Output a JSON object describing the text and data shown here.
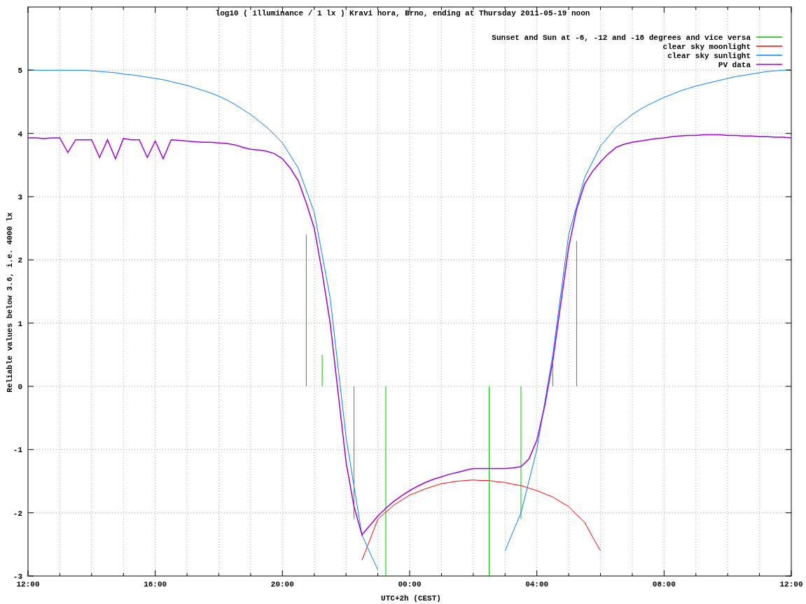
{
  "chart_data": {
    "type": "line",
    "title": "log10 ( illuminance / 1 lx ) Kravi hora, Brno, ending at Thursday 2011-05-19 noon",
    "xlabel": "UTC+2h (CEST)",
    "ylabel": "Reliable values below 3.6, i.e. 4000 lx",
    "categories": [
      "12:00",
      null,
      null,
      null,
      null,
      null,
      null,
      null,
      null,
      null,
      null,
      null,
      null,
      null,
      null,
      null,
      "16:00",
      null,
      null,
      null,
      null,
      null,
      null,
      null,
      null,
      null,
      null,
      null,
      null,
      null,
      null,
      null,
      "20:00",
      null,
      null,
      null,
      null,
      null,
      null,
      null,
      null,
      null,
      null,
      null,
      null,
      null,
      null,
      null,
      "00:00",
      null,
      null,
      null,
      null,
      null,
      null,
      null,
      null,
      null,
      null,
      null,
      null,
      null,
      null,
      null,
      "04:00",
      null,
      null,
      null,
      null,
      null,
      null,
      null,
      null,
      null,
      null,
      null,
      null,
      null,
      null,
      null,
      "08:00",
      null,
      null,
      null,
      null,
      null,
      null,
      null,
      null,
      null,
      null,
      null,
      null,
      null,
      null,
      null,
      "12:00"
    ],
    "ylim": [
      -3,
      6
    ],
    "yticks": [
      -3,
      -2,
      -1,
      0,
      1,
      2,
      3,
      4,
      5
    ],
    "grid": true,
    "legend": true,
    "series": [
      {
        "name": "Sunset and Sun at -6, -12 and -18 degrees and vice versa",
        "color": "#00c000",
        "type": "bar",
        "values": [
          null,
          null,
          null,
          null,
          null,
          null,
          null,
          null,
          null,
          null,
          null,
          null,
          null,
          null,
          null,
          null,
          null,
          null,
          null,
          null,
          null,
          null,
          null,
          null,
          null,
          null,
          null,
          null,
          null,
          null,
          null,
          null,
          null,
          null,
          null,
          2.4,
          null,
          0.5,
          null,
          null,
          null,
          -2.1,
          null,
          null,
          null,
          -3,
          null,
          null,
          null,
          null,
          null,
          null,
          null,
          null,
          null,
          null,
          null,
          null,
          -3,
          null,
          null,
          null,
          -2.1,
          null,
          null,
          null,
          0.35,
          null,
          null,
          2.3,
          null,
          null,
          null,
          null,
          null,
          null,
          null,
          null,
          null,
          null,
          null,
          null,
          null,
          null,
          null,
          null,
          null,
          null,
          null,
          null,
          null,
          null,
          null,
          null,
          null,
          null,
          null
        ]
      },
      {
        "name": "clear sky moonlight",
        "color": "#ff0000",
        "values": [
          null,
          null,
          null,
          null,
          null,
          null,
          null,
          null,
          null,
          null,
          null,
          null,
          null,
          null,
          null,
          null,
          null,
          null,
          null,
          null,
          null,
          null,
          null,
          null,
          null,
          null,
          null,
          null,
          null,
          null,
          null,
          null,
          null,
          null,
          null,
          null,
          null,
          null,
          null,
          null,
          null,
          null,
          -2.75,
          -2.43,
          -2.1,
          -1.99,
          -1.88,
          -1.8,
          -1.72,
          -1.67,
          -1.62,
          -1.58,
          -1.54,
          -1.52,
          -1.5,
          -1.49,
          -1.48,
          -1.49,
          -1.49,
          -1.51,
          -1.52,
          -1.55,
          -1.57,
          -1.61,
          -1.65,
          -1.7,
          -1.75,
          -1.83,
          -1.9,
          -2.03,
          -2.15,
          -2.38,
          -2.6,
          null,
          null,
          null,
          null,
          null,
          null,
          null,
          null,
          null,
          null,
          null,
          null,
          null,
          null,
          null,
          null,
          null,
          null,
          null,
          null,
          null,
          null,
          null,
          null
        ]
      },
      {
        "name": "clear sky sunlight",
        "color": "#0080ff",
        "values": [
          5.01,
          5.0,
          5.0,
          5.0,
          5.0,
          5.0,
          5.0,
          5.0,
          4.99,
          4.98,
          4.97,
          4.96,
          4.94,
          4.93,
          4.91,
          4.89,
          4.87,
          4.85,
          4.82,
          4.79,
          4.76,
          4.72,
          4.68,
          4.64,
          4.59,
          4.53,
          4.46,
          4.38,
          4.3,
          4.2,
          4.1,
          3.98,
          3.85,
          3.65,
          3.45,
          3.1,
          2.75,
          2.08,
          1.4,
          0.3,
          -0.8,
          -1.58,
          -2.35,
          -2.63,
          -2.9,
          null,
          null,
          null,
          null,
          null,
          null,
          null,
          null,
          null,
          null,
          null,
          null,
          null,
          null,
          null,
          -2.6,
          -2.3,
          -2.0,
          -1.5,
          -1.0,
          -0.25,
          0.5,
          1.45,
          2.4,
          2.85,
          3.3,
          3.55,
          3.8,
          3.95,
          4.1,
          4.2,
          4.3,
          4.38,
          4.45,
          4.51,
          4.57,
          4.62,
          4.67,
          4.71,
          4.75,
          4.78,
          4.81,
          4.84,
          4.87,
          4.9,
          4.92,
          4.94,
          4.96,
          4.98,
          4.99,
          5.0,
          5.01
        ]
      },
      {
        "name": "PV data",
        "color": "#a000e0",
        "values": [
          3.93,
          3.93,
          3.92,
          3.93,
          3.93,
          3.7,
          3.9,
          3.9,
          3.9,
          3.62,
          3.9,
          3.6,
          3.92,
          3.9,
          3.9,
          3.62,
          3.88,
          3.6,
          3.9,
          3.89,
          3.88,
          3.87,
          3.86,
          3.86,
          3.85,
          3.84,
          3.82,
          3.78,
          3.75,
          3.74,
          3.72,
          3.68,
          3.6,
          3.45,
          3.25,
          2.9,
          2.5,
          1.8,
          1.0,
          -0.1,
          -1.2,
          -1.9,
          -2.35,
          -2.2,
          -2.05,
          -1.93,
          -1.82,
          -1.73,
          -1.65,
          -1.58,
          -1.52,
          -1.47,
          -1.43,
          -1.39,
          -1.36,
          -1.33,
          -1.3,
          -1.3,
          -1.3,
          -1.3,
          -1.3,
          -1.29,
          -1.27,
          -1.15,
          -0.85,
          -0.3,
          0.4,
          1.3,
          2.2,
          2.8,
          3.2,
          3.4,
          3.55,
          3.68,
          3.78,
          3.83,
          3.86,
          3.88,
          3.9,
          3.92,
          3.93,
          3.95,
          3.96,
          3.97,
          3.97,
          3.98,
          3.98,
          3.98,
          3.97,
          3.97,
          3.96,
          3.96,
          3.95,
          3.95,
          3.94,
          3.94,
          3.93
        ]
      }
    ]
  }
}
